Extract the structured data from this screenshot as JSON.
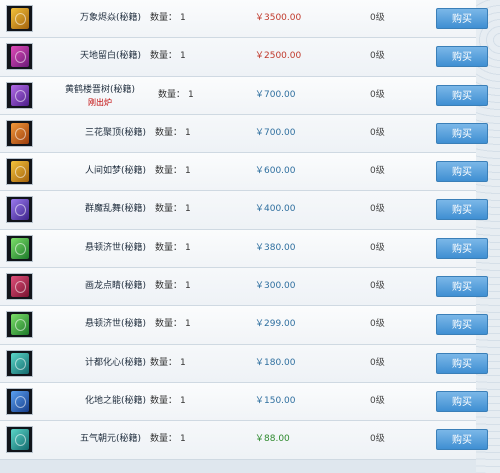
{
  "colors": {
    "price_red": "#c0392b",
    "price_blue": "#2f6f9f",
    "price_green": "#2f8a2f",
    "button": "#4a96d6"
  },
  "buy_label": "购买",
  "qty_label": "数量：",
  "items": [
    {
      "name": "万象烬焱(秘籍)",
      "qty": "1",
      "price": "￥3500.00",
      "level": "0级",
      "icon": "gold-book-icon",
      "price_color": "red"
    },
    {
      "name": "天地留白(秘籍)",
      "qty": "1",
      "price": "￥2500.00",
      "level": "0级",
      "icon": "magenta-book-icon",
      "price_color": "red"
    },
    {
      "name": "黄鹤楼晋树(秘籍)",
      "sub": "刚出炉",
      "qty": "1",
      "price": "￥700.00",
      "level": "0级",
      "icon": "purple-book-icon",
      "price_color": "blue"
    },
    {
      "name": "三花聚顶(秘籍)",
      "qty": "1",
      "price": "￥700.00",
      "level": "0级",
      "icon": "orange-book-icon",
      "price_color": "blue"
    },
    {
      "name": "人间如梦(秘籍)",
      "qty": "1",
      "price": "￥600.00",
      "level": "0级",
      "icon": "gold-book-icon",
      "price_color": "blue"
    },
    {
      "name": "群魔乱舞(秘籍)",
      "qty": "1",
      "price": "￥400.00",
      "level": "0级",
      "icon": "violet-book-icon",
      "price_color": "blue"
    },
    {
      "name": "悬顿济世(秘籍)",
      "qty": "1",
      "price": "￥380.00",
      "level": "0级",
      "icon": "green-book-icon",
      "price_color": "blue"
    },
    {
      "name": "画龙点睛(秘籍)",
      "qty": "1",
      "price": "￥300.00",
      "level": "0级",
      "icon": "crimson-book-icon",
      "price_color": "blue"
    },
    {
      "name": "悬顿济世(秘籍)",
      "qty": "1",
      "price": "￥299.00",
      "level": "0级",
      "icon": "green-book-icon",
      "price_color": "blue"
    },
    {
      "name": "计都化心(秘籍)",
      "qty": "1",
      "price": "￥180.00",
      "level": "0级",
      "icon": "teal-book-icon",
      "price_color": "blue"
    },
    {
      "name": "化地之能(秘籍)",
      "qty": "1",
      "price": "￥150.00",
      "level": "0级",
      "icon": "blue-book-icon",
      "price_color": "blue"
    },
    {
      "name": "五气朝元(秘籍)",
      "qty": "1",
      "price": "￥88.00",
      "level": "0级",
      "icon": "teal-book-icon",
      "price_color": "green"
    }
  ]
}
